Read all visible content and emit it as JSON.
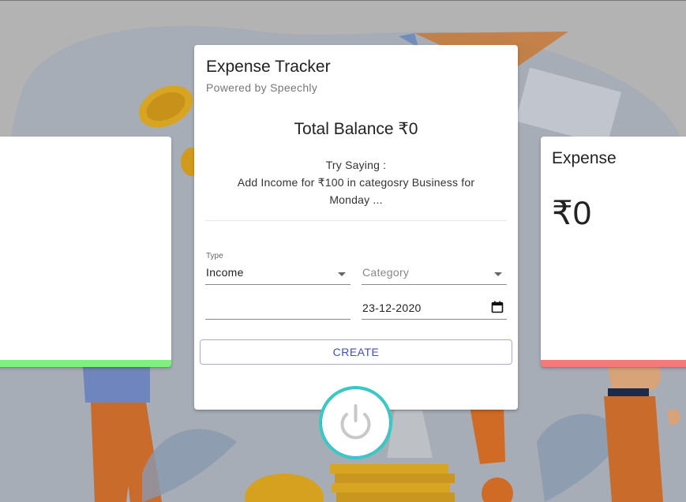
{
  "app": {
    "title": "Expense Tracker",
    "subtitle": "Powered by Speechly"
  },
  "balance": {
    "text": "Total Balance ₹0"
  },
  "hint": {
    "line1": "Try Saying :",
    "line2": "Add Income for ₹100 in categosry Business for Monday ..."
  },
  "form": {
    "type_label": "Type",
    "type_value": "Income",
    "category_placeholder": "Category",
    "amount_value": "",
    "date_value": "23-12-2020",
    "create_label": "CREATE"
  },
  "expense_card": {
    "title": "Expense",
    "amount": "₹0"
  },
  "colors": {
    "income_accent": "#7ef07e",
    "expense_accent": "#f47a7a",
    "primary": "#3f51b5",
    "power_ring": "#2fcfbf"
  },
  "icons": {
    "type_dropdown": "chevron-down-icon",
    "category_dropdown": "chevron-down-icon",
    "date_picker": "calendar-icon",
    "mic_button": "power-icon"
  }
}
